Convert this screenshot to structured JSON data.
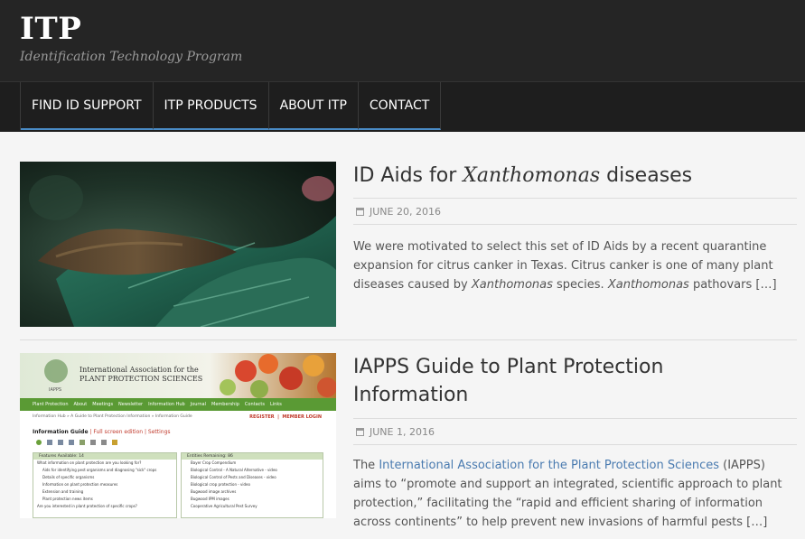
{
  "site": {
    "title": "ITP",
    "description": "Identification Technology Program"
  },
  "nav": {
    "items": [
      {
        "label": "FIND ID SUPPORT"
      },
      {
        "label": "ITP PRODUCTS"
      },
      {
        "label": "ABOUT ITP"
      },
      {
        "label": "CONTACT"
      }
    ]
  },
  "posts": [
    {
      "title_pre": "ID Aids for ",
      "title_italic": "Xanthomonas",
      "title_post": " diseases",
      "date": "JUNE 20, 2016",
      "excerpt_1": "We were motivated to select this set of ID Aids by a recent quarantine expansion for citrus canker in Texas. Citrus canker is one of many plant diseases caused by ",
      "excerpt_italic_1": "Xanthomonas",
      "excerpt_2": " species. ",
      "excerpt_italic_2": "Xanthomonas",
      "excerpt_3": " pathovars […]"
    },
    {
      "title": "IAPPS Guide to Plant Protection Information",
      "date": "JUNE 1, 2016",
      "excerpt_pre": "The ",
      "excerpt_link": "International Association for the Plant Protection Sciences",
      "excerpt_post": " (IAPPS) aims to “promote and support an integrated, scientific approach to plant protection,” facilitating the “rapid and efficient sharing of information across continents” to help prevent new invasions of harmful pests […]",
      "thumb": {
        "header": "International Association for the PLANT PROTECTION SCIENCES",
        "logo": "IAPPS",
        "menu": [
          "Plant Protection",
          "About",
          "Meetings",
          "Newsletter",
          "Information Hub",
          "Journal",
          "Membership",
          "Contacts",
          "Links"
        ],
        "breadcrumb": "Information Hub » A Guide to Plant Protection Information » Information Guide",
        "register": "REGISTER  |  MEMBER LOGIN",
        "guide_title": "Information Guide",
        "guide_links": "| Full screen edition | Settings",
        "left_header": "Features Available: 14",
        "left_items": [
          "What information on plant protection are you looking for?",
          "Aids for identifying pest organisms and diagnosing \"sick\" crops",
          "Details of specific organisms",
          "Information on plant protection measures",
          "Extension and training",
          "Plant protection news items",
          "Are you interested in plant protection of specific crops?"
        ],
        "right_header": "Entities Remaining: 86",
        "right_items": [
          "Bayer Crop Compendium",
          "Biological Control - A Natural Alternative - video",
          "Biological Control of Pests and Diseases - video",
          "Biological crop protection - video",
          "Bugwood image archives",
          "Bugwood IPM images",
          "Cooperative Agricultural Pest Survey"
        ]
      }
    }
  ],
  "colors": {
    "header_bg": "#252525",
    "nav_accent": "#4a8cc7",
    "link": "#4a7bb0"
  }
}
